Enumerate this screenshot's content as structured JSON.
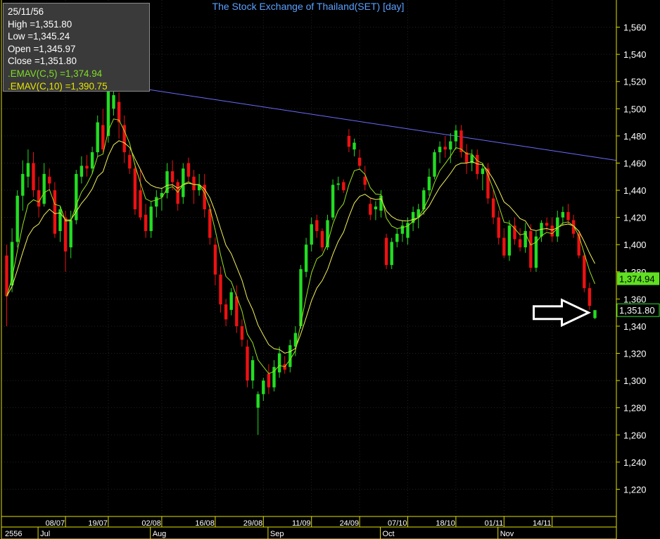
{
  "colors": {
    "background": "#000000",
    "frame": "#e0e000",
    "up_candle": "#22dd22",
    "down_candle": "#ee1111",
    "ema5": "#9be020",
    "ema10": "#f2f25a",
    "trendline": "#6b6bff",
    "title": "#5aa0ff"
  },
  "info_box": {
    "date": "25/11/56",
    "high": "High  =1,351.80",
    "low": "Low  =1,345.24",
    "open": "Open  =1,345.97",
    "close": "Close  =1,351.80",
    "ema5": ".EMAV(C,5)   =1,374.94",
    "ema10": ".EMAV(C,10)  =1,390.75"
  },
  "chart_data": {
    "type": "candlestick",
    "title": "The Stock Exchange of Thailand(SET) [day]",
    "ylim": [
      1200,
      1580
    ],
    "yticks": [
      1220,
      1240,
      1260,
      1280,
      1300,
      1320,
      1340,
      1360,
      1380,
      1400,
      1420,
      1440,
      1460,
      1480,
      1500,
      1520,
      1540,
      1560
    ],
    "ytick_labels": [
      "1,220",
      "1,240",
      "1,260",
      "1,280",
      "1,300",
      "1,320",
      "1,340",
      "1,360",
      "1,380",
      "1,400",
      "1,420",
      "1,440",
      "1,460",
      "1,480",
      "1,500",
      "1,520",
      "1,540",
      "1,560"
    ],
    "date_ticks": [
      {
        "label": "08/07",
        "index": 11
      },
      {
        "label": "19/07",
        "index": 19
      },
      {
        "label": "02/08",
        "index": 29
      },
      {
        "label": "16/08",
        "index": 39
      },
      {
        "label": "29/08",
        "index": 48
      },
      {
        "label": "11/09",
        "index": 57
      },
      {
        "label": "24/09",
        "index": 66
      },
      {
        "label": "07/10",
        "index": 75
      },
      {
        "label": "18/10",
        "index": 84
      },
      {
        "label": "01/11",
        "index": 93
      },
      {
        "label": "14/11",
        "index": 102
      }
    ],
    "month_labels": [
      {
        "label": "2556",
        "index": 0
      },
      {
        "label": "Jul",
        "index": 6
      },
      {
        "label": "Aug",
        "index": 27
      },
      {
        "label": "Sep",
        "index": 49
      },
      {
        "label": "Oct",
        "index": 70
      },
      {
        "label": "Nov",
        "index": 92
      }
    ],
    "ohlc": [
      [
        1392,
        1400,
        1340,
        1362
      ],
      [
        1370,
        1412,
        1365,
        1402
      ],
      [
        1402,
        1440,
        1398,
        1436
      ],
      [
        1436,
        1462,
        1425,
        1452
      ],
      [
        1450,
        1470,
        1442,
        1460
      ],
      [
        1460,
        1468,
        1435,
        1440
      ],
      [
        1440,
        1450,
        1420,
        1428
      ],
      [
        1430,
        1460,
        1428,
        1452
      ],
      [
        1450,
        1456,
        1440,
        1445
      ],
      [
        1440,
        1446,
        1405,
        1408
      ],
      [
        1410,
        1428,
        1402,
        1426
      ],
      [
        1420,
        1425,
        1380,
        1395
      ],
      [
        1398,
        1425,
        1390,
        1418
      ],
      [
        1418,
        1455,
        1415,
        1452
      ],
      [
        1450,
        1465,
        1445,
        1458
      ],
      [
        1458,
        1466,
        1450,
        1456
      ],
      [
        1456,
        1472,
        1452,
        1468
      ],
      [
        1468,
        1495,
        1465,
        1490
      ],
      [
        1488,
        1500,
        1468,
        1470
      ],
      [
        1480,
        1525,
        1475,
        1518
      ],
      [
        1500,
        1518,
        1495,
        1510
      ],
      [
        1505,
        1512,
        1478,
        1490
      ],
      [
        1488,
        1495,
        1460,
        1468
      ],
      [
        1466,
        1470,
        1452,
        1456
      ],
      [
        1456,
        1460,
        1422,
        1426
      ],
      [
        1440,
        1455,
        1418,
        1420
      ],
      [
        1422,
        1430,
        1405,
        1410
      ],
      [
        1410,
        1432,
        1405,
        1428
      ],
      [
        1428,
        1440,
        1420,
        1435
      ],
      [
        1435,
        1442,
        1425,
        1438
      ],
      [
        1438,
        1460,
        1434,
        1454
      ],
      [
        1454,
        1462,
        1440,
        1446
      ],
      [
        1446,
        1448,
        1425,
        1430
      ],
      [
        1435,
        1460,
        1430,
        1456
      ],
      [
        1460,
        1464,
        1446,
        1450
      ],
      [
        1450,
        1455,
        1430,
        1440
      ],
      [
        1440,
        1452,
        1436,
        1444
      ],
      [
        1444,
        1452,
        1420,
        1426
      ],
      [
        1426,
        1430,
        1400,
        1405
      ],
      [
        1400,
        1405,
        1370,
        1378
      ],
      [
        1378,
        1384,
        1350,
        1356
      ],
      [
        1356,
        1360,
        1340,
        1345
      ],
      [
        1352,
        1368,
        1348,
        1365
      ],
      [
        1362,
        1370,
        1335,
        1340
      ],
      [
        1340,
        1345,
        1325,
        1330
      ],
      [
        1325,
        1330,
        1295,
        1300
      ],
      [
        1300,
        1318,
        1294,
        1315
      ],
      [
        1280,
        1292,
        1260,
        1290
      ],
      [
        1290,
        1302,
        1285,
        1300
      ],
      [
        1305,
        1312,
        1290,
        1295
      ],
      [
        1295,
        1315,
        1292,
        1310
      ],
      [
        1306,
        1325,
        1302,
        1320
      ],
      [
        1312,
        1318,
        1305,
        1308
      ],
      [
        1310,
        1330,
        1306,
        1326
      ],
      [
        1325,
        1340,
        1318,
        1335
      ],
      [
        1340,
        1385,
        1338,
        1382
      ],
      [
        1380,
        1405,
        1376,
        1400
      ],
      [
        1400,
        1420,
        1395,
        1415
      ],
      [
        1418,
        1422,
        1405,
        1410
      ],
      [
        1410,
        1412,
        1395,
        1398
      ],
      [
        1398,
        1422,
        1396,
        1418
      ],
      [
        1420,
        1448,
        1418,
        1444
      ],
      [
        1444,
        1450,
        1440,
        1445
      ],
      [
        1446,
        1448,
        1438,
        1440
      ],
      [
        1480,
        1485,
        1468,
        1472
      ],
      [
        1470,
        1478,
        1465,
        1475
      ],
      [
        1464,
        1470,
        1455,
        1458
      ],
      [
        1450,
        1458,
        1440,
        1444
      ],
      [
        1430,
        1434,
        1418,
        1422
      ],
      [
        1426,
        1432,
        1418,
        1428
      ],
      [
        1425,
        1440,
        1420,
        1436
      ],
      [
        1405,
        1408,
        1382,
        1385
      ],
      [
        1385,
        1405,
        1382,
        1402
      ],
      [
        1402,
        1412,
        1398,
        1408
      ],
      [
        1408,
        1418,
        1402,
        1414
      ],
      [
        1405,
        1420,
        1400,
        1416
      ],
      [
        1416,
        1428,
        1410,
        1424
      ],
      [
        1420,
        1430,
        1412,
        1426
      ],
      [
        1426,
        1442,
        1422,
        1440
      ],
      [
        1440,
        1456,
        1436,
        1450
      ],
      [
        1450,
        1470,
        1448,
        1468
      ],
      [
        1468,
        1476,
        1460,
        1472
      ],
      [
        1472,
        1480,
        1464,
        1470
      ],
      [
        1470,
        1482,
        1460,
        1476
      ],
      [
        1476,
        1488,
        1470,
        1484
      ],
      [
        1484,
        1488,
        1464,
        1468
      ],
      [
        1468,
        1474,
        1452,
        1460
      ],
      [
        1460,
        1470,
        1454,
        1466
      ],
      [
        1466,
        1470,
        1448,
        1452
      ],
      [
        1452,
        1460,
        1440,
        1456
      ],
      [
        1456,
        1460,
        1430,
        1434
      ],
      [
        1434,
        1440,
        1415,
        1420
      ],
      [
        1420,
        1425,
        1400,
        1405
      ],
      [
        1405,
        1412,
        1390,
        1392
      ],
      [
        1392,
        1418,
        1388,
        1414
      ],
      [
        1414,
        1420,
        1400,
        1404
      ],
      [
        1404,
        1412,
        1395,
        1398
      ],
      [
        1398,
        1416,
        1394,
        1410
      ],
      [
        1410,
        1415,
        1380,
        1383
      ],
      [
        1383,
        1410,
        1380,
        1406
      ],
      [
        1406,
        1418,
        1402,
        1416
      ],
      [
        1416,
        1420,
        1410,
        1414
      ],
      [
        1414,
        1420,
        1402,
        1406
      ],
      [
        1406,
        1425,
        1402,
        1420
      ],
      [
        1420,
        1428,
        1414,
        1424
      ],
      [
        1424,
        1430,
        1415,
        1418
      ],
      [
        1418,
        1422,
        1405,
        1408
      ],
      [
        1408,
        1410,
        1390,
        1392
      ],
      [
        1392,
        1394,
        1365,
        1368
      ],
      [
        1368,
        1372,
        1352,
        1355
      ],
      [
        1345.97,
        1351.8,
        1345.24,
        1351.8
      ]
    ],
    "series": [
      {
        "name": ".EMAV(C,5)",
        "last": 1374.94
      },
      {
        "name": ".EMAV(C,10)",
        "last": 1390.75
      }
    ],
    "value_tags": [
      {
        "label": "1,374.94",
        "value": 1374.94,
        "series": "ema5"
      },
      {
        "label": "1,351.80",
        "value": 1351.8,
        "series": "close"
      }
    ],
    "trendline": {
      "start_index": 20,
      "start_value": 1518,
      "end_index": 115,
      "end_value": 1462
    },
    "arrow_annotation": {
      "points_to_index": 110,
      "direction": "right"
    }
  }
}
